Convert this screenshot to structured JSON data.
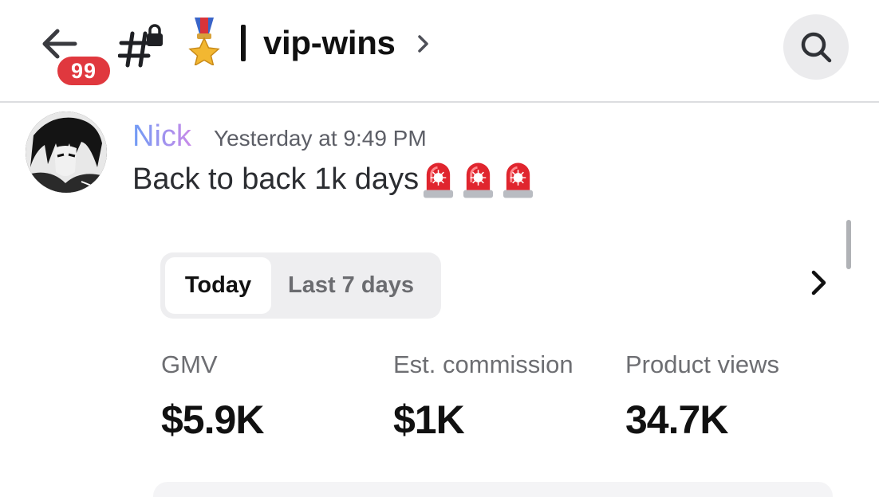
{
  "header": {
    "notification_count": "99",
    "channel_emoji_name": "military-medal",
    "channel_name": "vip-wins",
    "back_icon": "arrow-left-icon",
    "channel_icon": "locked-text-channel-icon",
    "search_icon": "search-icon"
  },
  "message": {
    "author": "Nick",
    "author_colors": [
      "#6f9cf5",
      "#c98be9"
    ],
    "timestamp": "Yesterday at 9:49 PM",
    "text": "Back to back 1k days",
    "emojis": [
      "police-car-light",
      "police-car-light",
      "police-car-light"
    ]
  },
  "embed": {
    "tabs": [
      {
        "label": "Today",
        "selected": true
      },
      {
        "label": "Last 7 days",
        "selected": false
      }
    ],
    "metrics": [
      {
        "label": "GMV",
        "value": "$5.9K"
      },
      {
        "label": "Est. commission",
        "value": "$1K"
      },
      {
        "label": "Product views",
        "value": "34.7K"
      }
    ]
  },
  "colors": {
    "badge": "#e0383e",
    "divider": "#dcdde0",
    "search_bg": "#ebebed"
  }
}
